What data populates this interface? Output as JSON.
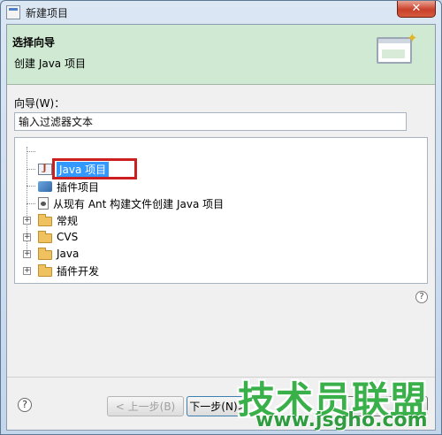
{
  "window": {
    "title": "新建项目",
    "close_glyph": "✕"
  },
  "banner": {
    "title": "选择向导",
    "description": "创建 Java 项目"
  },
  "wizard": {
    "label": "向导(W)：",
    "filter_value": "输入过滤器文本"
  },
  "tree": {
    "items": [
      {
        "label": "Java 项目",
        "icon": "java-project-icon",
        "selected": true
      },
      {
        "label": "插件项目",
        "icon": "plugin-project-icon"
      },
      {
        "label": "从现有 Ant 构建文件创建 Java 项目",
        "icon": "ant-build-file-icon"
      },
      {
        "label": "常规",
        "icon": "folder-icon",
        "expander": "+"
      },
      {
        "label": "CVS",
        "icon": "folder-icon",
        "expander": "+"
      },
      {
        "label": "Java",
        "icon": "folder-icon",
        "expander": "+"
      },
      {
        "label": "插件开发",
        "icon": "folder-icon",
        "expander": "+"
      }
    ]
  },
  "buttons": {
    "back": "< 上一步(B)",
    "next": "下一步(N)>",
    "finish": ""
  },
  "help_glyph": "?",
  "watermark": {
    "text": "技术员联盟",
    "url": "www.jsgho.com"
  },
  "colors": {
    "banner_bg": "#cfe9d2",
    "selection": "#3399ff",
    "highlight_box": "#cc1f1f",
    "watermark": "#3ab04a"
  }
}
